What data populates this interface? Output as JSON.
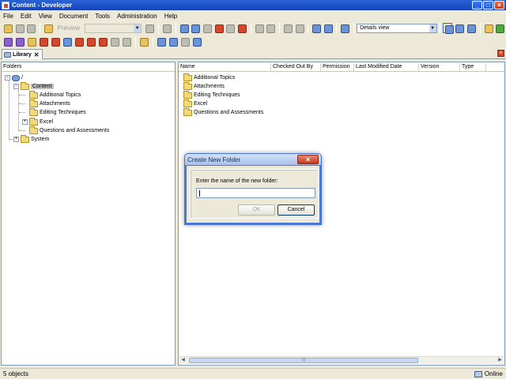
{
  "window": {
    "title": "Content - Developer"
  },
  "menu": [
    "File",
    "Edit",
    "View",
    "Document",
    "Tools",
    "Administration",
    "Help"
  ],
  "toolbar": {
    "preview_label": "Preview",
    "view_select": "Details view"
  },
  "tab": {
    "label": "Library"
  },
  "folders_pane": {
    "header": "Folders",
    "root": "/",
    "selected": "Content",
    "children": [
      "Additional Topics",
      "Attachments",
      "Editing Techniques",
      "Excel",
      "Questions and Assessments"
    ],
    "system": "System"
  },
  "list_pane": {
    "columns": [
      "Name",
      "Checked Out By",
      "Permission",
      "Last Modified Date",
      "Version",
      "Type"
    ],
    "rows": [
      "Additional Topics",
      "Attachments",
      "Editing Techniques",
      "Excel",
      "Questions and Assessments"
    ]
  },
  "dialog": {
    "title": "Create New Folder",
    "prompt": "Enter the name of the new folder:",
    "input_value": "",
    "ok_label": "OK",
    "cancel_label": "Cancel"
  },
  "status": {
    "left": "5 objects",
    "right": "Online"
  }
}
